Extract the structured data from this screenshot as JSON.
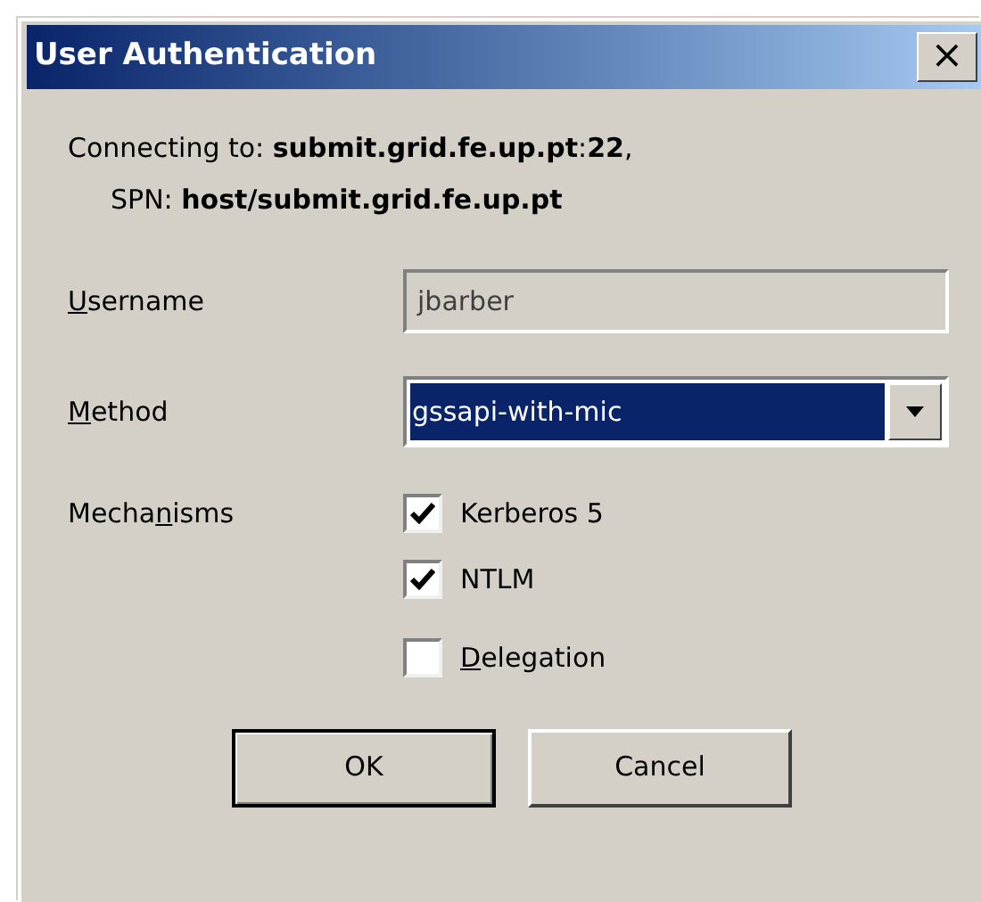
{
  "window": {
    "title": "User Authentication",
    "close_button": "×"
  },
  "connection": {
    "line_1": "Connecting to: **submit.grid.fe.up.pt**:**22**,",
    "line_2": "SPN: **host/submit.grid.fe.up.pt**"
  },
  "fields": [
    {
      "kind": "text",
      "access_key": "U",
      "label_after": "sername",
      "value": "jbarber",
      "disabled": true
    },
    {
      "kind": "dropdown",
      "access_key": "M",
      "label_after": "ethod",
      "value": "gssapi-with-mic",
      "focused": true
    }
  ],
  "mechanisms": {
    "label_before": "Mecha",
    "access_key": "n",
    "label_after": "isms",
    "options": [
      {
        "label_before": "Kerberos 5",
        "checked": true
      },
      {
        "label_before": "NTLM",
        "checked": true
      }
    ]
  },
  "delegation": {
    "access_key": "D",
    "label_after": "elegation",
    "checked": false
  },
  "buttons": [
    {
      "label": "OK",
      "default": true
    },
    {
      "label": "Cancel",
      "default": false
    }
  ]
}
